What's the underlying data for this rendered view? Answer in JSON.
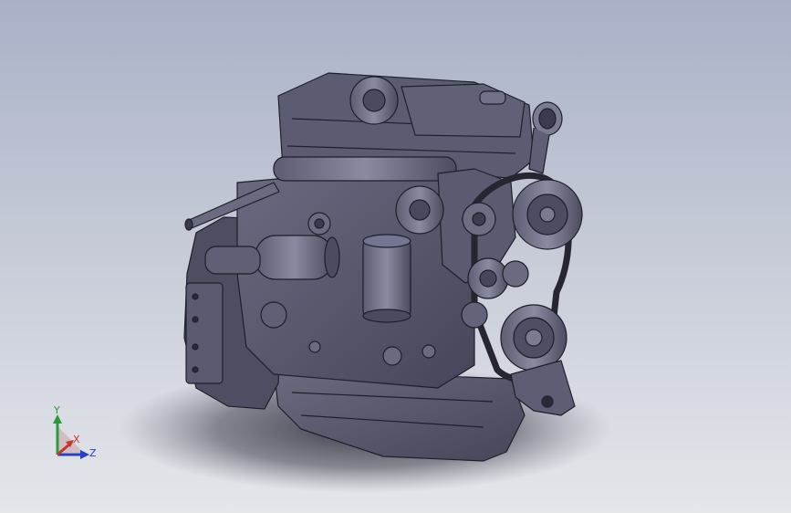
{
  "viewport": {
    "background_top": "#a9b1c7",
    "background_bottom": "#e4e6ea",
    "model_color": "#55566a",
    "model_edge_color": "#1e1f2b"
  },
  "triad": {
    "x_label": "X",
    "y_label": "Y",
    "z_label": "Z",
    "x_color": "#c0392b",
    "y_color": "#2a9a3a",
    "z_color": "#2340c8"
  }
}
